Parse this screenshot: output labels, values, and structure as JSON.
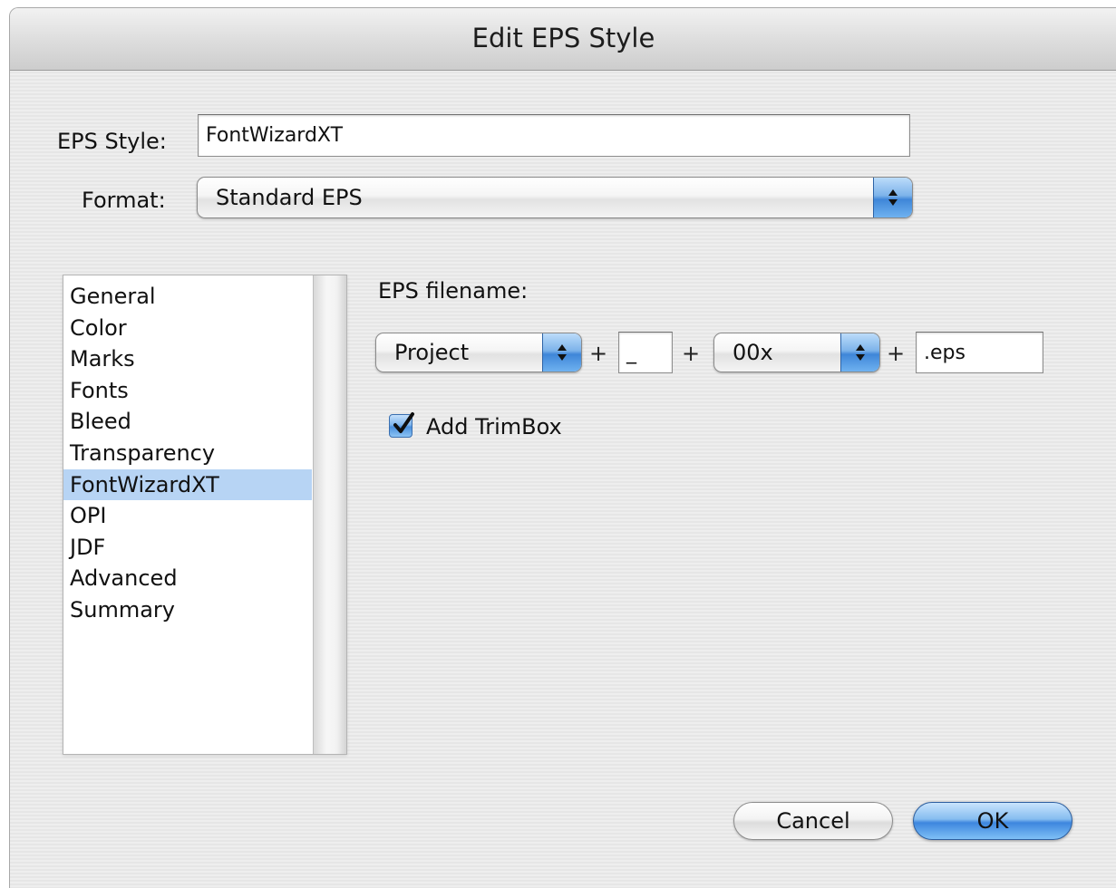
{
  "window": {
    "title": "Edit EPS Style"
  },
  "eps_style": {
    "label": "EPS Style:",
    "value": "FontWizardXT"
  },
  "format": {
    "label": "Format:",
    "selected": "Standard EPS"
  },
  "sidebar": {
    "items": [
      {
        "label": "General",
        "selected": false
      },
      {
        "label": "Color",
        "selected": false
      },
      {
        "label": "Marks",
        "selected": false
      },
      {
        "label": "Fonts",
        "selected": false
      },
      {
        "label": "Bleed",
        "selected": false
      },
      {
        "label": "Transparency",
        "selected": false
      },
      {
        "label": "FontWizardXT",
        "selected": true
      },
      {
        "label": "OPI",
        "selected": false
      },
      {
        "label": "JDF",
        "selected": false
      },
      {
        "label": "Advanced",
        "selected": false
      },
      {
        "label": "Summary",
        "selected": false
      }
    ]
  },
  "filename": {
    "label": "EPS filename:",
    "part1_selected": "Project",
    "plus": "+",
    "separator_value": "_",
    "part2_selected": "00x",
    "extension_value": ".eps"
  },
  "trimbox": {
    "label": "Add TrimBox",
    "checked": true
  },
  "buttons": {
    "cancel": "Cancel",
    "ok": "OK"
  },
  "colors": {
    "selection": "#b7d4f4",
    "accent": "#3f86d8"
  },
  "icons": {
    "popup": "up-down-arrows-icon",
    "check": "checkmark-icon"
  }
}
